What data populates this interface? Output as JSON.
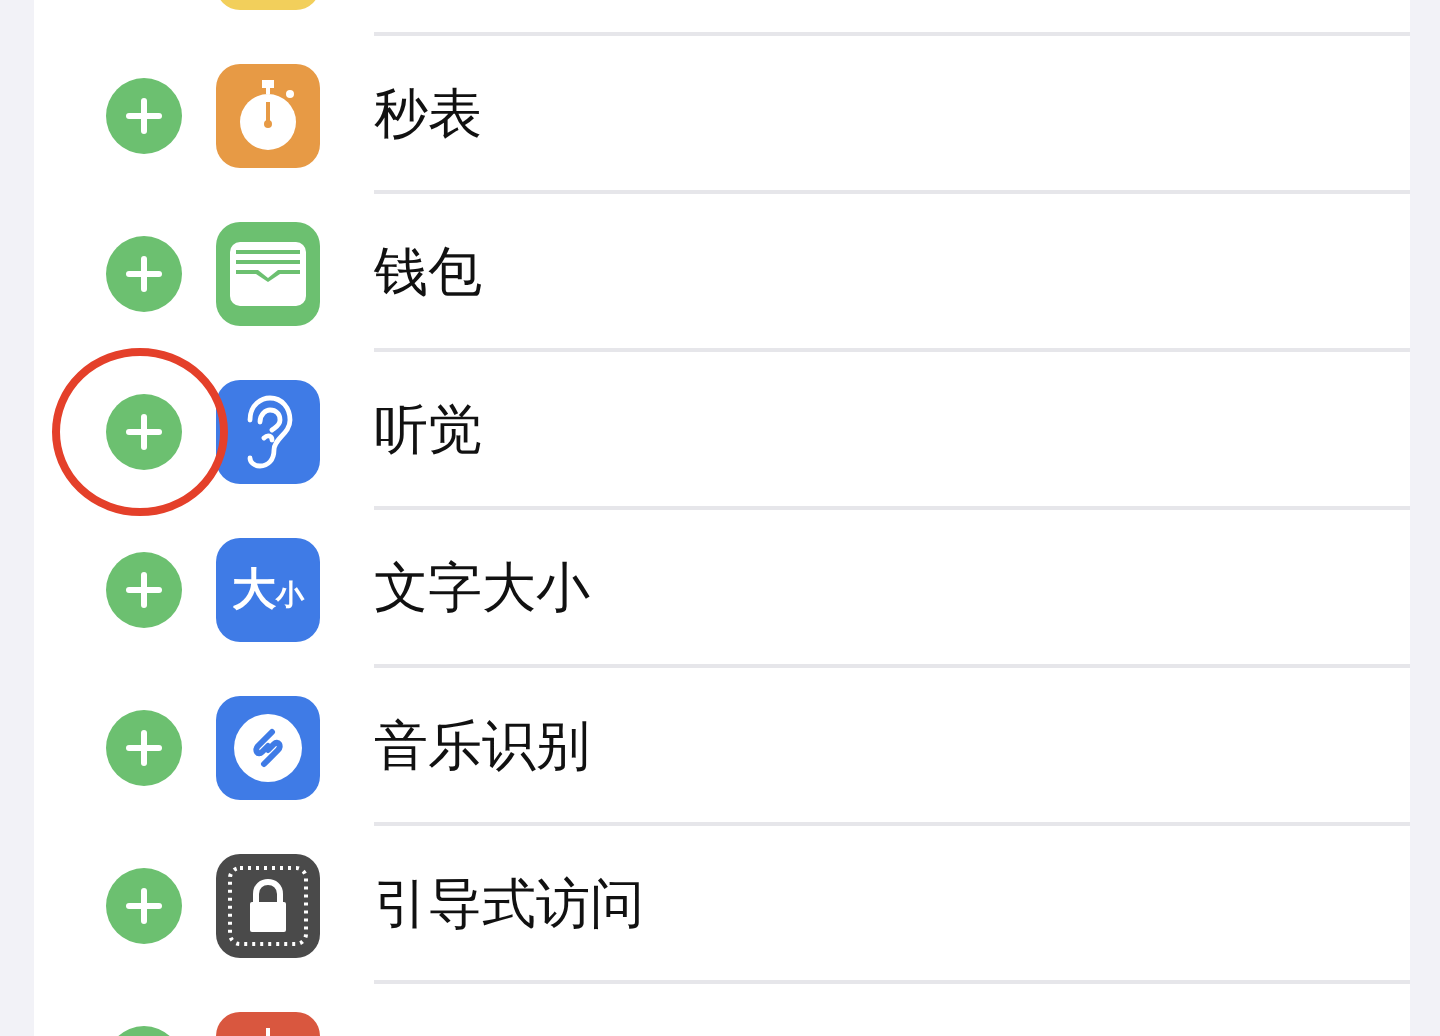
{
  "controls": [
    {
      "kind": "notes",
      "circled": false
    },
    {
      "kind": "stopwatch",
      "label": "秒表",
      "circled": false
    },
    {
      "kind": "wallet",
      "label": "钱包",
      "circled": false
    },
    {
      "kind": "hearing",
      "label": "听觉",
      "circled": true
    },
    {
      "kind": "text-size",
      "label": "文字大小",
      "circled": false,
      "icon_big": "大",
      "icon_small": "小"
    },
    {
      "kind": "music-recognition",
      "label": "音乐识别",
      "circled": false
    },
    {
      "kind": "guided-access",
      "label": "引导式访问",
      "circled": false
    },
    {
      "kind": "red-app",
      "circled": false
    }
  ]
}
